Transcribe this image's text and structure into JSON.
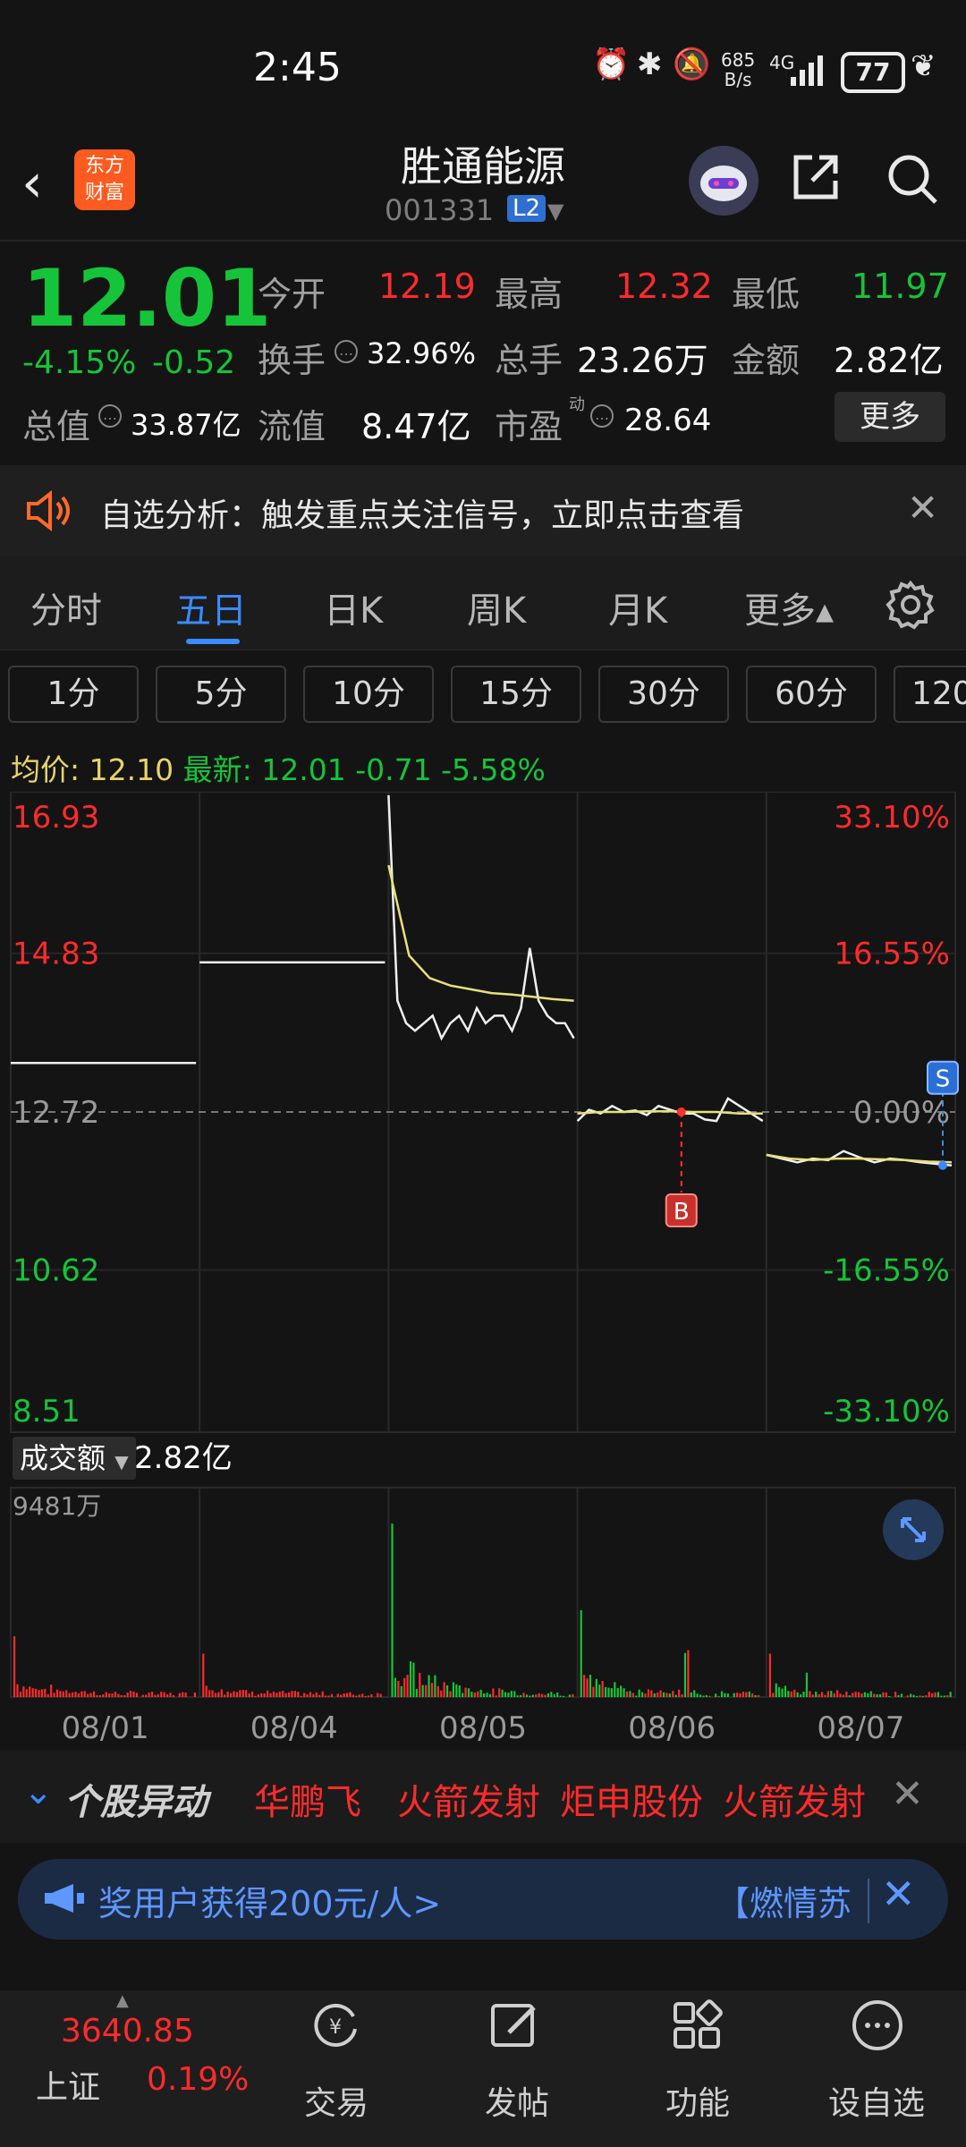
{
  "status_bar": {
    "time": "2:45",
    "net_speed_value": "685",
    "net_speed_unit": "B/s",
    "network": "4G",
    "battery": "77"
  },
  "header": {
    "stock_name": "胜通能源",
    "stock_code": "001331",
    "level_badge": "L2",
    "logo_text_1": "东方",
    "logo_text_2": "财富"
  },
  "quote": {
    "price": "12.01",
    "change_pct": "-4.15%",
    "change": "-0.52",
    "open_label": "今开",
    "open": "12.19",
    "high_label": "最高",
    "high": "12.32",
    "low_label": "最低",
    "low": "11.97",
    "turnover_label": "换手",
    "turnover": "32.96%",
    "volume_label": "总手",
    "volume": "23.26万",
    "amount_label": "金额",
    "amount": "2.82亿",
    "mktcap_label": "总值",
    "mktcap": "33.87亿",
    "float_label": "流值",
    "float": "8.47亿",
    "pe_label": "市盈",
    "pe_sup": "动",
    "pe": "28.64",
    "more_label": "更多"
  },
  "banner": {
    "text": "自选分析：触发重点关注信号，立即点击查看"
  },
  "tabs": [
    "分时",
    "五日",
    "日K",
    "周K",
    "月K",
    "更多▴"
  ],
  "active_tab": "五日",
  "periods": [
    "1分",
    "5分",
    "10分",
    "15分",
    "30分",
    "60分",
    "120"
  ],
  "avg_line": {
    "avg_label": "均价:",
    "avg": "12.10",
    "last_label": "最新:",
    "last": "12.01",
    "chg": "-0.71",
    "pct": "-5.58%"
  },
  "volume_section": {
    "label": "成交额",
    "value": "2.82亿",
    "max": "9481万"
  },
  "alert": {
    "title": "个股异动",
    "items": [
      "华鹏飞",
      "火箭发射",
      "炬申股份",
      "火箭发射"
    ]
  },
  "promo": {
    "text": "奖用户获得200元/人>",
    "text2": "【燃情苏"
  },
  "bottom_nav": {
    "index_value": "3640.85",
    "index_name": "上证",
    "index_pct": "0.19%",
    "items": [
      "交易",
      "发帖",
      "功能",
      "设自选"
    ]
  },
  "colors": {
    "up": "#ff2b2b",
    "down": "#16c43a",
    "accent": "#3a8bff",
    "avg_line": "#e8e07a"
  },
  "chart_data": {
    "type": "line",
    "title": "五日",
    "xlabel": "",
    "ylabel": "",
    "y_left_ticks": [
      "16.93",
      "14.83",
      "12.72",
      "10.62",
      "8.51"
    ],
    "y_right_ticks": [
      "33.10%",
      "16.55%",
      "0.00%",
      "-16.55%",
      "-33.10%"
    ],
    "x_ticks": [
      "08/01",
      "08/04",
      "08/05",
      "08/06",
      "08/07"
    ],
    "ylim": [
      8.51,
      16.93
    ],
    "markers": [
      {
        "label": "B",
        "day": "08/06",
        "price": 12.72
      },
      {
        "label": "S",
        "day": "08/07",
        "price": 12.01
      }
    ],
    "series": [
      {
        "name": "价格",
        "day_segments": [
          {
            "day": "08/01",
            "values": [
              13.37,
              13.37,
              13.37
            ]
          },
          {
            "day": "08/04",
            "values": [
              14.71,
              14.71,
              14.71
            ]
          },
          {
            "day": "08/05",
            "values": [
              16.93,
              14.2,
              13.9,
              13.8,
              13.9,
              14.0,
              13.7,
              13.9,
              14.0,
              13.8,
              14.1,
              13.9,
              14.0,
              14.0,
              13.8,
              14.1,
              14.9,
              14.2,
              14.0,
              13.9,
              13.9,
              13.7
            ]
          },
          {
            "day": "08/06",
            "values": [
              12.6,
              12.75,
              12.7,
              12.8,
              12.72,
              12.74,
              12.68,
              12.8,
              12.75,
              12.7,
              12.7,
              12.62,
              12.6,
              12.9,
              12.8,
              12.7,
              12.6
            ]
          },
          {
            "day": "08/07",
            "values": [
              12.15,
              12.1,
              12.05,
              12.1,
              12.08,
              12.2,
              12.12,
              12.05,
              12.1,
              12.08,
              12.05,
              12.03,
              12.01
            ]
          }
        ]
      },
      {
        "name": "均价",
        "day_segments": [
          {
            "day": "08/05",
            "values": [
              16.0,
              14.8,
              14.5,
              14.4,
              14.35,
              14.3,
              14.28,
              14.25,
              14.22,
              14.2
            ]
          },
          {
            "day": "08/06",
            "values": [
              12.7,
              12.72,
              12.72,
              12.73,
              12.73,
              12.72,
              12.72,
              12.7,
              12.7
            ]
          },
          {
            "day": "08/07",
            "values": [
              12.15,
              12.1,
              12.08,
              12.1,
              12.1,
              12.09,
              12.08,
              12.06,
              12.05
            ]
          }
        ]
      }
    ],
    "volume": {
      "max": "9481万",
      "bars": [
        {
          "day": "08/01",
          "peak": 0.35
        },
        {
          "day": "08/04",
          "peak": 0.25
        },
        {
          "day": "08/05",
          "peak": 1.0
        },
        {
          "day": "08/06",
          "peak": 0.5
        },
        {
          "day": "08/07",
          "peak": 0.25
        }
      ]
    }
  }
}
